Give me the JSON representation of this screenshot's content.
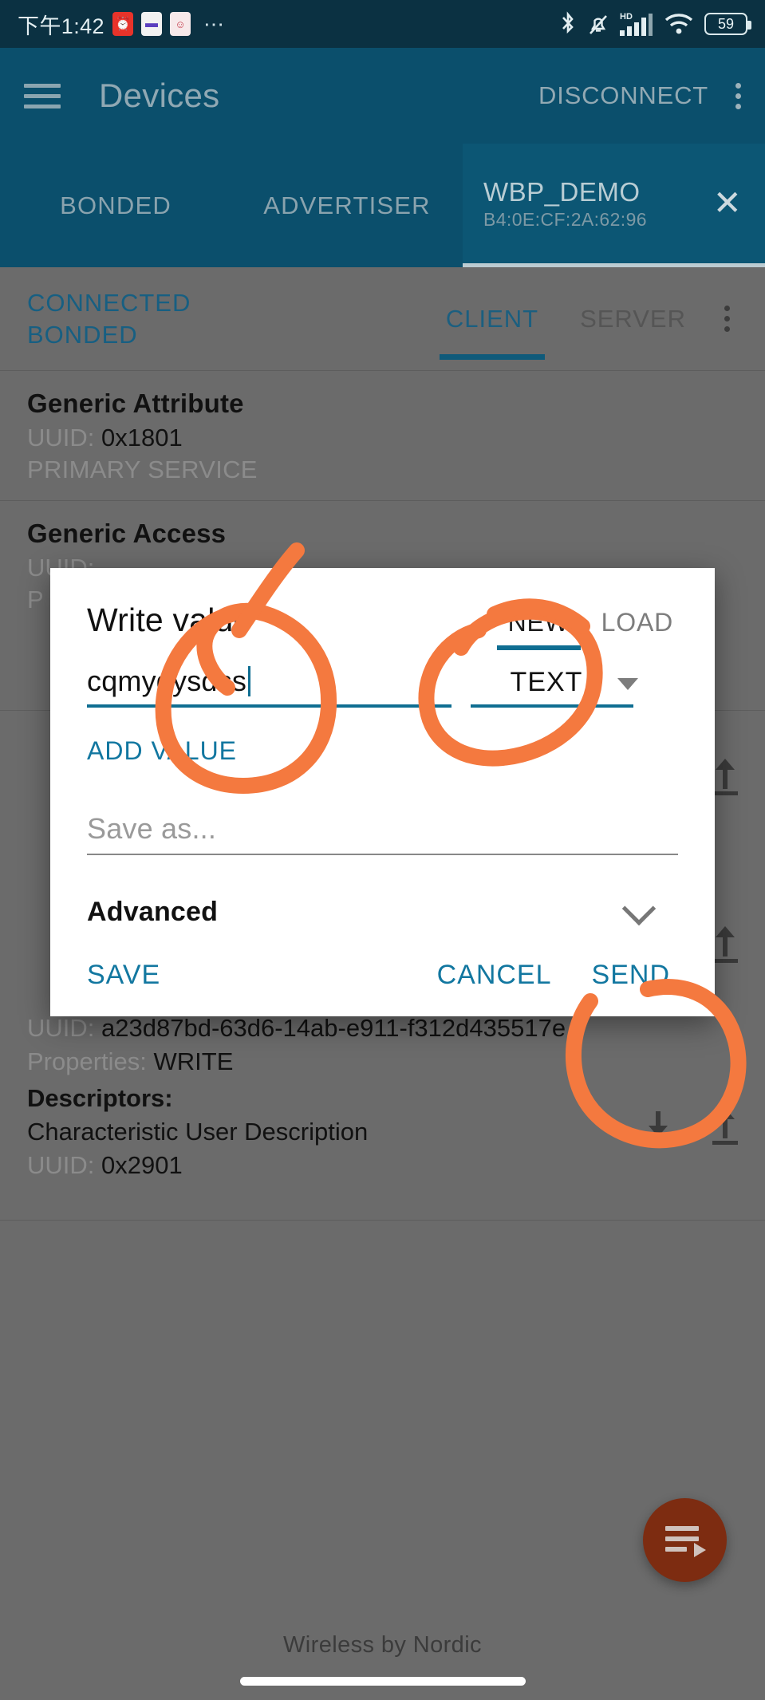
{
  "status_bar": {
    "time": "下午1:42",
    "icons": [
      "alarm-icon",
      "minus-icon",
      "app-icon",
      "more-dots-icon",
      "bluetooth-icon",
      "silent-bell-icon",
      "hd-signal-icon",
      "wifi-icon",
      "battery-icon"
    ],
    "battery_percent": "59",
    "hd_label": "HD"
  },
  "app_bar": {
    "menu_icon": "hamburger-icon",
    "title": "Devices",
    "action": "DISCONNECT",
    "overflow_icon": "kebab-icon"
  },
  "tabs": [
    {
      "label": "BONDED",
      "active": false
    },
    {
      "label": "ADVERTISER",
      "active": false
    }
  ],
  "device_tab": {
    "name": "WBP_DEMO",
    "address": "B4:0E:CF:2A:62:96",
    "close_icon": "close-icon",
    "active": true
  },
  "connection": {
    "state": "CONNECTED",
    "bond": "BONDED"
  },
  "client_server_tabs": [
    {
      "label": "CLIENT",
      "active": true
    },
    {
      "label": "SERVER",
      "active": false
    }
  ],
  "services": [
    {
      "name": "Generic Attribute",
      "uuid_label": "UUID:",
      "uuid": "0x1801",
      "type": "PRIMARY SERVICE"
    },
    {
      "name": "Generic Access",
      "uuid_label": "UUID:",
      "uuid": "",
      "type": ""
    }
  ],
  "characteristic": {
    "uuid_label": "UUID:",
    "uuid": "a23d87bd-63d6-14ab-e911-f312d435517e",
    "properties_label": "Properties:",
    "properties": "WRITE",
    "descriptors_label": "Descriptors:",
    "descriptor_name": "Characteristic User Description",
    "descriptor_uuid_label": "UUID:",
    "descriptor_uuid": "0x2901",
    "read_icon": "download-arrow-icon",
    "write_icon": "upload-arrow-icon"
  },
  "dialog": {
    "title": "Write value",
    "segments": [
      {
        "label": "NEW",
        "active": true
      },
      {
        "label": "LOAD",
        "active": false
      }
    ],
    "value_input": "cqmygysdss",
    "value_type": "TEXT",
    "type_dropdown_icon": "caret-down-icon",
    "add_value_label": "ADD VALUE",
    "save_as_placeholder": "Save as...",
    "save_as_value": "",
    "advanced_label": "Advanced",
    "advanced_chevron_icon": "chevron-down-icon",
    "buttons": [
      {
        "label": "SAVE",
        "name": "save-button"
      },
      {
        "label": "CANCEL",
        "name": "cancel-button"
      },
      {
        "label": "SEND",
        "name": "send-button"
      }
    ]
  },
  "fab": {
    "icon": "playlist-play-icon",
    "color": "#7d2c11"
  },
  "footer": {
    "text": "Wireless by Nordic"
  },
  "annotations": {
    "color": "#f47b43",
    "marks": [
      "circle-around-value-input",
      "circle-around-type-and-new",
      "circle-around-send-button"
    ]
  },
  "colors": {
    "app_bar": "#0b4f6c",
    "status_bar": "#0b3142",
    "accent": "#0f6e92",
    "link": "#1277a0",
    "scrim": "#6b6b6b"
  }
}
